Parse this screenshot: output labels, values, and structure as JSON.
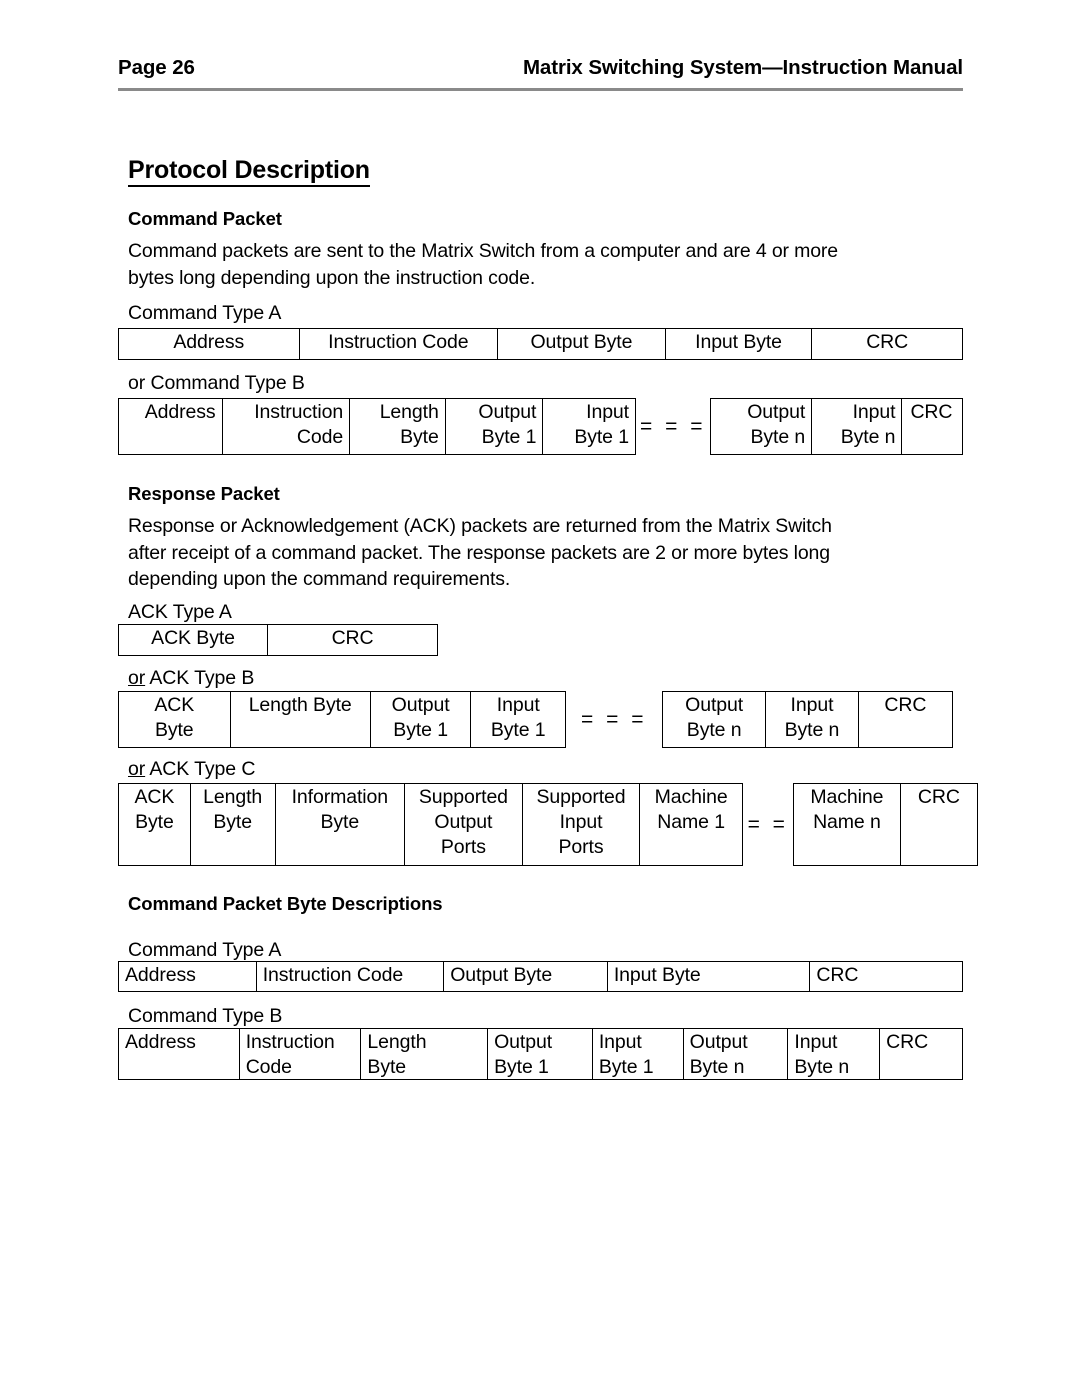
{
  "header": {
    "page_label": "Page 26",
    "manual_title": "Matrix Switching System—Instruction Manual"
  },
  "title": "Protocol Description",
  "sections": {
    "command_packet": {
      "heading": "Command Packet",
      "paragraph_line1": "Command packets are sent to the Matrix Switch from a computer and are 4 or more",
      "paragraph_line2": "bytes long depending upon the instruction code."
    },
    "response_packet": {
      "heading": "Response Packet",
      "paragraph_line1": "Response or Acknowledgement (ACK) packets are returned from the Matrix Switch",
      "paragraph_line2": "after receipt of a command packet. The response packets are 2 or more bytes long",
      "paragraph_line3": "depending upon the command requirements."
    },
    "byte_descriptions": {
      "heading": "Command Packet Byte Descriptions"
    }
  },
  "captions": {
    "command_type_a": "Command Type A",
    "or_command_type_b_prefix": "or ",
    "or_command_type_b": "Command Type B",
    "ack_type_a": "ACK Type A",
    "or_prefix_underlined": "or",
    "ack_type_b": " ACK Type B",
    "ack_type_c": " ACK Type C",
    "desc_command_type_a": "Command Type A",
    "desc_command_type_b": "Command Type B"
  },
  "separators": {
    "three_equals": "= = =",
    "two_equals": "= ="
  },
  "tables": {
    "command_type_a": {
      "align": "center",
      "cells": [
        {
          "line1": "Address",
          "line2": ""
        },
        {
          "line1": "Instruction Code",
          "line2": ""
        },
        {
          "line1": "Output Byte",
          "line2": ""
        },
        {
          "line1": "Input Byte",
          "line2": ""
        },
        {
          "line1": "CRC",
          "line2": ""
        }
      ]
    },
    "command_type_b": {
      "align": "right",
      "left_cells": [
        {
          "line1": "Address",
          "line2": ""
        },
        {
          "line1": "Instruction",
          "line2": "Code"
        },
        {
          "line1": "Length",
          "line2": "Byte"
        },
        {
          "line1": "Output",
          "line2": "Byte 1"
        },
        {
          "line1": "Input",
          "line2": "Byte 1"
        }
      ],
      "right_cells": [
        {
          "line1": "Output",
          "line2": "Byte n"
        },
        {
          "line1": "Input",
          "line2": "Byte n"
        },
        {
          "line1": "CRC",
          "line2": ""
        }
      ]
    },
    "ack_type_a": {
      "align": "center",
      "cells": [
        {
          "line1": "ACK Byte",
          "line2": ""
        },
        {
          "line1": "CRC",
          "line2": ""
        }
      ]
    },
    "ack_type_b": {
      "align": "center",
      "left_cells": [
        {
          "line1": "ACK",
          "line2": "Byte"
        },
        {
          "line1": "Length Byte",
          "line2": ""
        },
        {
          "line1": "Output",
          "line2": "Byte 1"
        },
        {
          "line1": "Input",
          "line2": "Byte 1"
        }
      ],
      "right_cells": [
        {
          "line1": "Output",
          "line2": "Byte n"
        },
        {
          "line1": "Input",
          "line2": "Byte n"
        },
        {
          "line1": "CRC",
          "line2": ""
        }
      ]
    },
    "ack_type_c": {
      "align": "center",
      "left_cells": [
        {
          "line1": "ACK",
          "line2": "Byte",
          "line3": ""
        },
        {
          "line1": "Length",
          "line2": "Byte",
          "line3": ""
        },
        {
          "line1": "Information",
          "line2": "Byte",
          "line3": ""
        },
        {
          "line1": "Supported",
          "line2": "Output",
          "line3": "Ports"
        },
        {
          "line1": "Supported",
          "line2": "Input",
          "line3": "Ports"
        },
        {
          "line1": "Machine",
          "line2": "Name 1",
          "line3": ""
        }
      ],
      "right_cells": [
        {
          "line1": "Machine",
          "line2": "Name n",
          "line3": ""
        },
        {
          "line1": "CRC",
          "line2": "",
          "line3": ""
        }
      ]
    },
    "desc_command_type_a": {
      "align": "left",
      "cells": [
        {
          "line1": "Address",
          "line2": ""
        },
        {
          "line1": "Instruction Code",
          "line2": ""
        },
        {
          "line1": "Output Byte",
          "line2": ""
        },
        {
          "line1": "Input Byte",
          "line2": ""
        },
        {
          "line1": "CRC",
          "line2": ""
        }
      ]
    },
    "desc_command_type_b": {
      "align": "left",
      "cells": [
        {
          "line1": "Address",
          "line2": ""
        },
        {
          "line1": "Instruction",
          "line2": "Code"
        },
        {
          "line1": "Length",
          "line2": "Byte"
        },
        {
          "line1": "Output",
          "line2": "Byte 1"
        },
        {
          "line1": "Input",
          "line2": "Byte 1"
        },
        {
          "line1": "Output",
          "line2": "Byte n"
        },
        {
          "line1": "Input",
          "line2": "Byte n"
        },
        {
          "line1": "CRC",
          "line2": ""
        }
      ]
    }
  }
}
